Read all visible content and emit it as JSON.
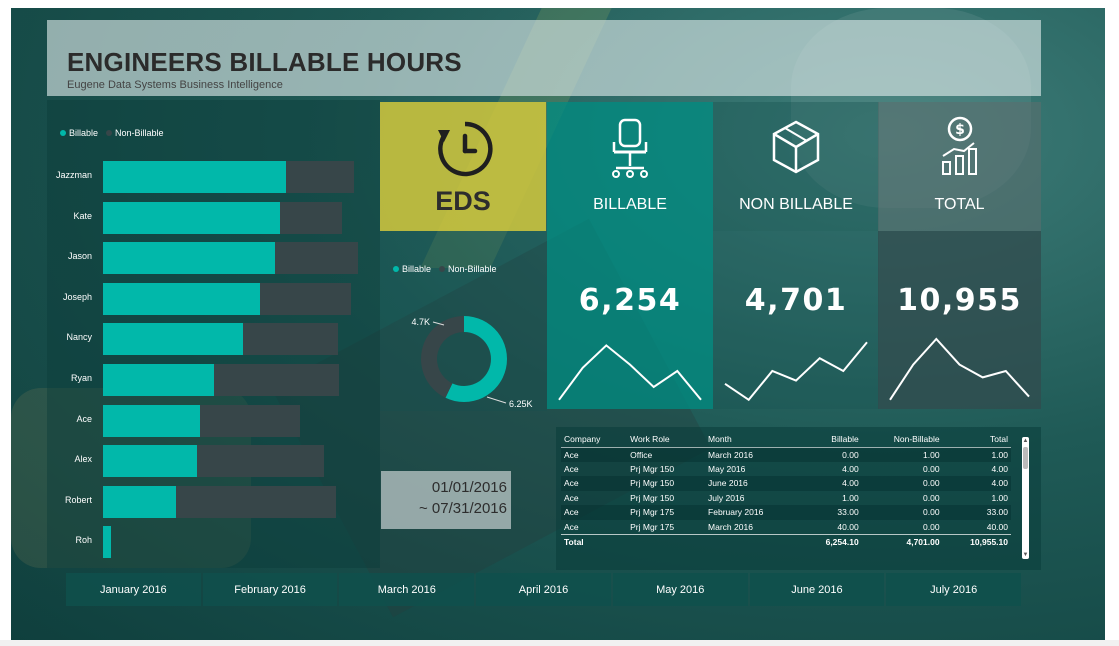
{
  "header": {
    "title": "ENGINEERS BILLABLE HOURS",
    "subtitle": "Eugene Data Systems Business Intelligence"
  },
  "legend": {
    "billable": "Billable",
    "non_billable": "Non-Billable"
  },
  "bar_chart": {
    "rows": [
      {
        "name": "Jazzman",
        "billable": 183,
        "non_billable": 68
      },
      {
        "name": "Kate",
        "billable": 177,
        "non_billable": 62
      },
      {
        "name": "Jason",
        "billable": 172,
        "non_billable": 83
      },
      {
        "name": "Joseph",
        "billable": 157,
        "non_billable": 91
      },
      {
        "name": "Nancy",
        "billable": 140,
        "non_billable": 95
      },
      {
        "name": "Ryan",
        "billable": 111,
        "non_billable": 125
      },
      {
        "name": "Ace",
        "billable": 97,
        "non_billable": 100
      },
      {
        "name": "Alex",
        "billable": 94,
        "non_billable": 127
      },
      {
        "name": "Robert",
        "billable": 73,
        "non_billable": 160
      },
      {
        "name": "Roh",
        "billable": 8,
        "non_billable": 0
      }
    ]
  },
  "eds_tile": {
    "label": "EDS",
    "icon": "clock-refresh-icon",
    "color": "#d2c83c"
  },
  "kpis": {
    "billable": {
      "label": "BILLABLE",
      "value": "6,254",
      "icon": "office-chair-icon",
      "trend": [
        0.05,
        0.55,
        0.9,
        0.6,
        0.25,
        0.5,
        0.05
      ]
    },
    "non_billable": {
      "label": "NON BILLABLE",
      "value": "4,701",
      "icon": "cube-icon",
      "trend": [
        0.3,
        0.05,
        0.5,
        0.35,
        0.7,
        0.5,
        0.95
      ]
    },
    "total": {
      "label": "TOTAL",
      "value": "10,955",
      "icon": "dollar-growth-icon",
      "trend": [
        0.05,
        0.6,
        1.0,
        0.6,
        0.4,
        0.5,
        0.1
      ]
    }
  },
  "donut": {
    "label_nb": "4.7K",
    "label_b": "6.25K",
    "billable": 6254,
    "non_billable": 4701
  },
  "date_range": {
    "start": "01/01/2016",
    "end": "~ 07/31/2016"
  },
  "table": {
    "columns": [
      "Company",
      "Work Role",
      "Month",
      "Billable",
      "Non-Billable",
      "Total"
    ],
    "rows": [
      [
        "Ace",
        "Office",
        "March 2016",
        "0.00",
        "1.00",
        "1.00"
      ],
      [
        "Ace",
        "Prj Mgr 150",
        "May 2016",
        "4.00",
        "0.00",
        "4.00"
      ],
      [
        "Ace",
        "Prj Mgr 150",
        "June 2016",
        "4.00",
        "0.00",
        "4.00"
      ],
      [
        "Ace",
        "Prj Mgr 150",
        "July 2016",
        "1.00",
        "0.00",
        "1.00"
      ],
      [
        "Ace",
        "Prj Mgr 175",
        "February 2016",
        "33.00",
        "0.00",
        "33.00"
      ],
      [
        "Ace",
        "Prj Mgr 175",
        "March 2016",
        "40.00",
        "0.00",
        "40.00"
      ]
    ],
    "total": [
      "Total",
      "",
      "",
      "6,254.10",
      "4,701.00",
      "10,955.10"
    ]
  },
  "months": [
    "January 2016",
    "February 2016",
    "March 2016",
    "April 2016",
    "May 2016",
    "June 2016",
    "July 2016"
  ],
  "colors": {
    "billable": "#01b8aa",
    "non_billable": "#374649",
    "accent_yellow": "#d2c83c"
  }
}
